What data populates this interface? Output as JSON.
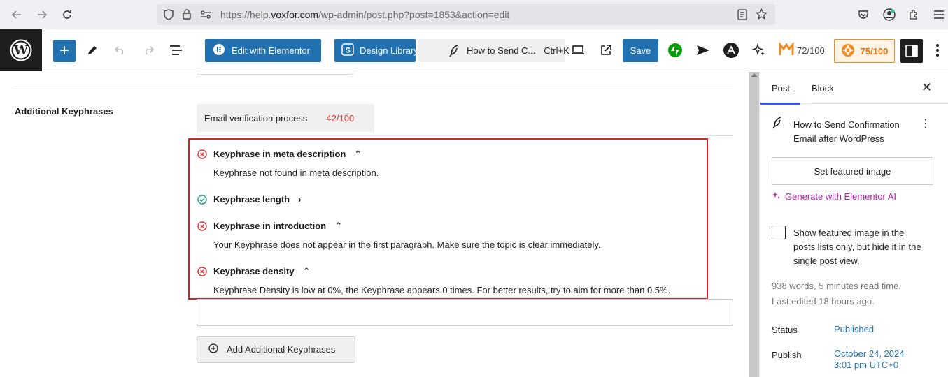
{
  "browser": {
    "url_prefix": "https://help.",
    "url_domain": "voxfor.com",
    "url_suffix": "/wp-admin/post.php?post=1853&action=edit"
  },
  "toolbar": {
    "elementor_label": "Edit with Elementor",
    "design_library_label": "Design Library",
    "doc_title": "How to Send C...",
    "doc_shortcut": "Ctrl+K",
    "save_label": "Save",
    "score_small": "72/100",
    "score_badge": "75/100"
  },
  "main": {
    "additional_keyphrases_label": "Additional Keyphrases",
    "keyphrase_tab": {
      "name": "Email verification process",
      "score": "42/100"
    },
    "results": [
      {
        "status": "bad",
        "title": "Keyphrase in meta description",
        "chevron": "up",
        "description": "Keyphrase not found in meta description."
      },
      {
        "status": "good",
        "title": "Keyphrase length",
        "chevron": "right",
        "description": ""
      },
      {
        "status": "bad",
        "title": "Keyphrase in introduction",
        "chevron": "up",
        "description": "Your Keyphrase does not appear in the first paragraph. Make sure the topic is clear immediately."
      },
      {
        "status": "bad",
        "title": "Keyphrase density",
        "chevron": "up",
        "description": "Keyphrase Density is low at 0%, the Keyphrase appears 0 times. For better results, try to aim for more than 0.5%."
      }
    ],
    "add_keyphrase_button": "Add Additional Keyphrases"
  },
  "sidebar": {
    "tab_post": "Post",
    "tab_block": "Block",
    "post_title": "How to Send Confirmation Email after WordPress",
    "set_featured_image": "Set featured image",
    "generate_ai": "Generate with Elementor AI",
    "featured_checkbox_text": "Show featured image in the posts lists only, but hide it in the single post view.",
    "stats": "938 words, 5 minutes read time.",
    "last_edited": "Last edited 18 hours ago.",
    "status_label": "Status",
    "status_value": "Published",
    "publish_label": "Publish",
    "publish_date": "October 24, 2024",
    "publish_time": "3:01 pm UTC+0"
  },
  "colors": {
    "wp_blue": "#2271b1",
    "error_red": "#dc3232",
    "success_green": "#1ea47a",
    "highlight_border": "#e31b23",
    "elementor_ai_pink": "#b31eab"
  }
}
